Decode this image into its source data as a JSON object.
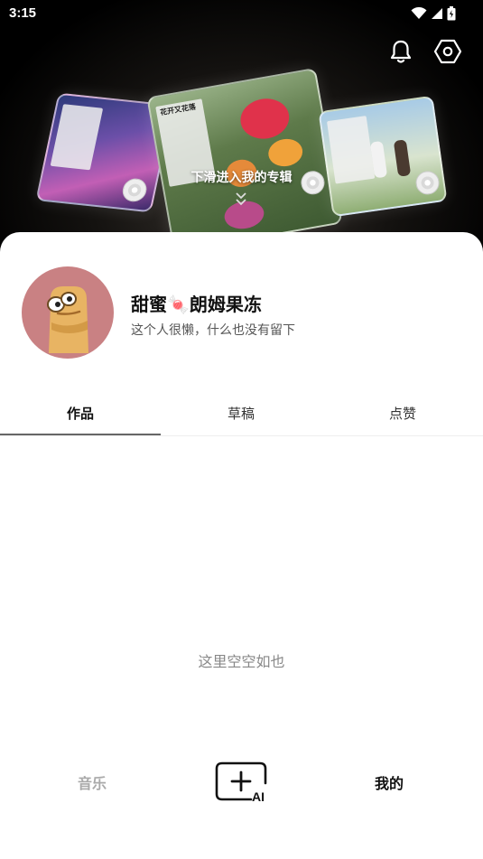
{
  "status_bar": {
    "time": "3:15"
  },
  "hero": {
    "swipe_hint": "下滑进入我的专辑",
    "album_title": "花开又花落"
  },
  "profile": {
    "username": "甜蜜🍬朗姆果冻",
    "bio": "这个人很懒，什么也没有留下"
  },
  "tabs": [
    {
      "label": "作品",
      "active": true
    },
    {
      "label": "草稿",
      "active": false
    },
    {
      "label": "点赞",
      "active": false
    }
  ],
  "empty_state": "这里空空如也",
  "bottom_nav": {
    "music": "音乐",
    "ai_label": "AI",
    "mine": "我的"
  },
  "colors": {
    "hero_bg": "#000000",
    "avatar_bg": "#c98183",
    "text_primary": "#111111",
    "text_muted": "#888888"
  }
}
